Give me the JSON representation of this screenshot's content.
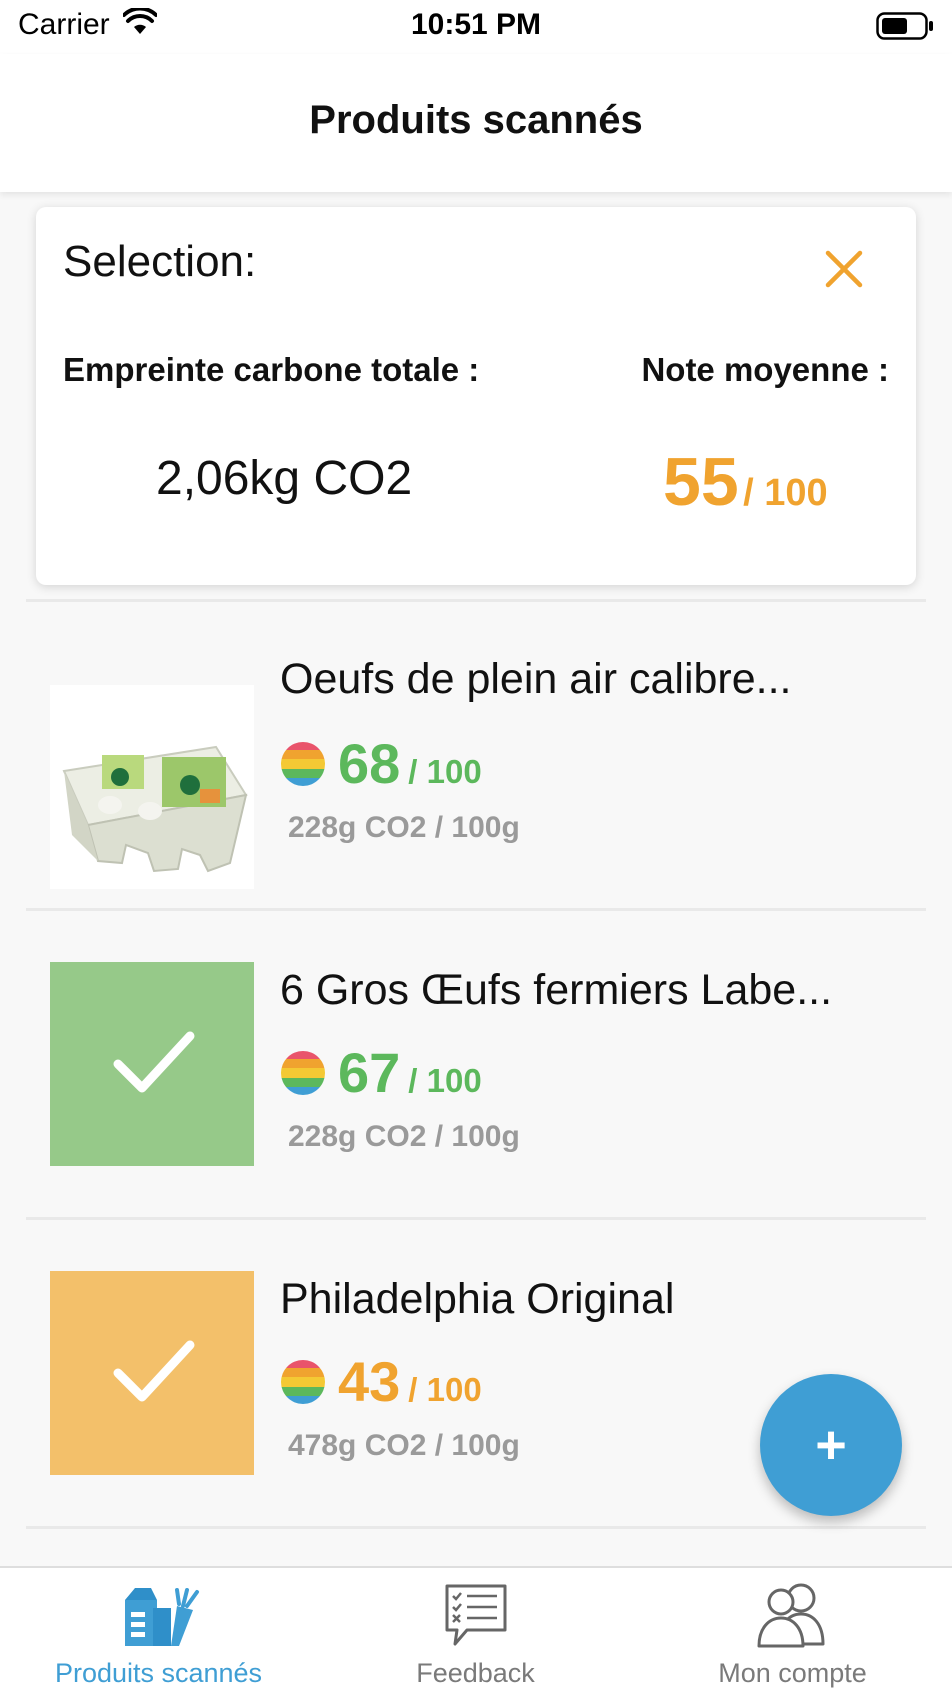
{
  "status_bar": {
    "carrier": "Carrier",
    "time": "10:51 PM"
  },
  "header": {
    "title": "Produits scannés"
  },
  "selection": {
    "title": "Selection:",
    "co2_label": "Empreinte carbone totale :",
    "note_label": "Note moyenne :",
    "co2_value": "2,06kg CO2",
    "note_value": "55",
    "note_max": "/ 100"
  },
  "products": [
    {
      "name": "Oeufs de plein air calibre...",
      "score": "68",
      "score_max": "/ 100",
      "score_color": "#5cb85c",
      "co2": "228g CO2 / 100g",
      "thumb": "product-photo"
    },
    {
      "name": "6 Gros Œufs fermiers Labe...",
      "score": "67",
      "score_max": "/ 100",
      "score_color": "#5cb85c",
      "co2": "228g CO2 / 100g",
      "thumb": "check-green"
    },
    {
      "name": "Philadelphia Original",
      "score": "43",
      "score_max": "/ 100",
      "score_color": "#f0a32f",
      "co2": "478g CO2 / 100g",
      "thumb": "check-orange"
    }
  ],
  "fab": {
    "label": "+"
  },
  "tabbar": {
    "tabs": [
      {
        "label": "Produits scannés",
        "icon": "grocery-bag-icon",
        "active": true
      },
      {
        "label": "Feedback",
        "icon": "feedback-checklist-icon",
        "active": false
      },
      {
        "label": "Mon compte",
        "icon": "users-icon",
        "active": false
      }
    ]
  },
  "colors": {
    "accent_blue": "#3f9ed4",
    "score_orange": "#f0a32f",
    "score_green": "#5cb85c",
    "check_green": "#96c989",
    "check_orange": "#f3c06a"
  }
}
